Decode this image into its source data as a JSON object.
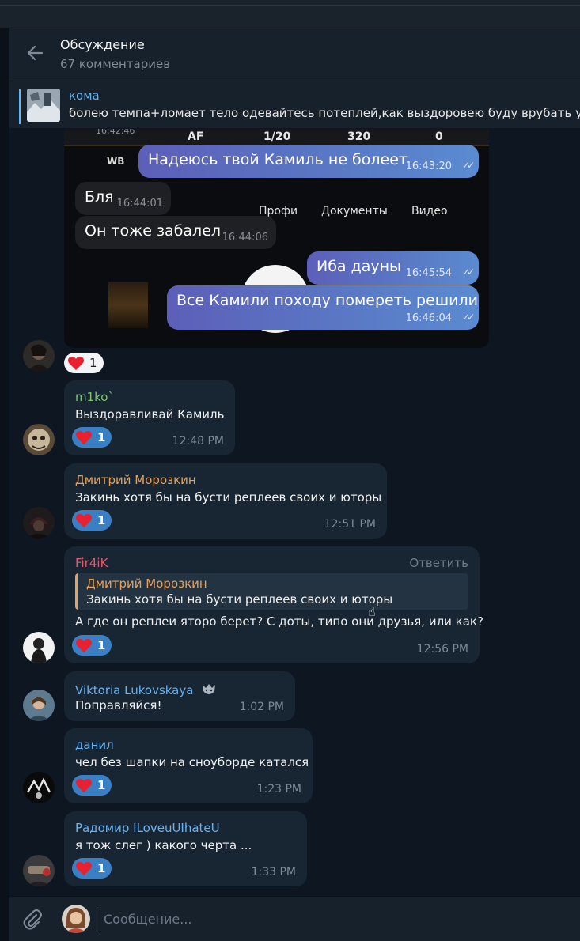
{
  "header": {
    "title": "Обсуждение",
    "subtitle": "67 комментариев"
  },
  "pinned": {
    "author": "кома",
    "text": "болею темпа+ломает тело одевайтесь потеплей,как выздоровею буду врубать  уст"
  },
  "screenshot": {
    "top_time": "16:42:46",
    "bar_labels": [
      "AF",
      "1/20",
      "320",
      "0"
    ],
    "wb": "WB",
    "tabs": [
      "Профи",
      "Документы",
      "Видео"
    ],
    "bubbles": [
      {
        "text": "Надеюсь твой Камиль не болеет",
        "time": "16:43:20",
        "out": true
      },
      {
        "text": "Бля",
        "time": "16:44:01",
        "out": false
      },
      {
        "text": "Он тоже забалел",
        "time": "16:44:06",
        "out": false
      },
      {
        "text": "Иба дауны",
        "time": "16:45:54",
        "out": true
      },
      {
        "text": "Все Камили походу помереть решили",
        "time": "16:46:04",
        "out": true
      }
    ],
    "reaction_count": "1"
  },
  "messages": [
    {
      "author": "m1ko`",
      "author_color": "#7cc96b",
      "text": "Выздоравливай Камиль",
      "reaction": "1",
      "time": "12:48 PM"
    },
    {
      "author": "Дмитрий Морозкин",
      "author_color": "#e8a15a",
      "text": "Закинь хотя бы на бусти реплеев своих и юторы",
      "reaction": "1",
      "time": "12:51 PM"
    },
    {
      "author": "Fir4iK",
      "author_color": "#e6586a",
      "reply_label": "Ответить",
      "quote_author": "Дмитрий Морозкин",
      "quote_text": "Закинь хотя бы на бусти реплеев своих и юторы",
      "text": "А где он реплеи яторо берет? С доты, типо они друзья, или как?",
      "reaction": "1",
      "time": "12:56 PM"
    },
    {
      "author": "Viktoria Lukovskaya",
      "author_color": "#6ab3f3",
      "text": "Поправляйся!",
      "time": "1:02 PM"
    },
    {
      "author": "данил",
      "author_color": "#6ab3f3",
      "text": "чел без шапки на сноуборде катался",
      "reaction": "1",
      "time": "1:23 PM"
    },
    {
      "author": "Радомир ILoveuUIhateU",
      "author_color": "#6ab3f3",
      "text": "я тож слег ) какого черта ...",
      "reaction": "1",
      "time": "1:33 PM"
    }
  ],
  "composer": {
    "placeholder": "Сообщение..."
  },
  "colors": {
    "background": "#0e1621",
    "panel": "#17212b",
    "bubble": "#182533",
    "accent": "#5eb5f7",
    "reaction": "#3a7fc4"
  }
}
